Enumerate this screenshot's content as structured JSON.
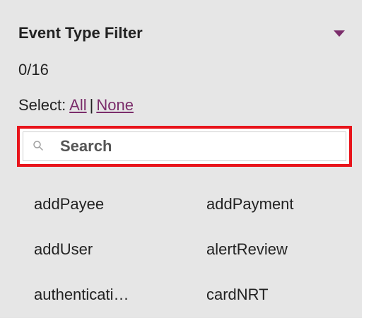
{
  "filter": {
    "title": "Event Type Filter",
    "count": "0/16",
    "select_prefix": "Select:",
    "select_all": "All",
    "select_separator": "|",
    "select_none": "None",
    "caret_icon": "caret-down-icon",
    "accent_color": "#7b2d6b",
    "highlight_color": "#e8141b"
  },
  "search": {
    "placeholder": "Search",
    "value": "",
    "icon": "search-icon"
  },
  "events": [
    {
      "label": "addPayee"
    },
    {
      "label": "addPayment"
    },
    {
      "label": "addUser"
    },
    {
      "label": "alertReview"
    },
    {
      "label": "authenticati…"
    },
    {
      "label": "cardNRT"
    }
  ]
}
